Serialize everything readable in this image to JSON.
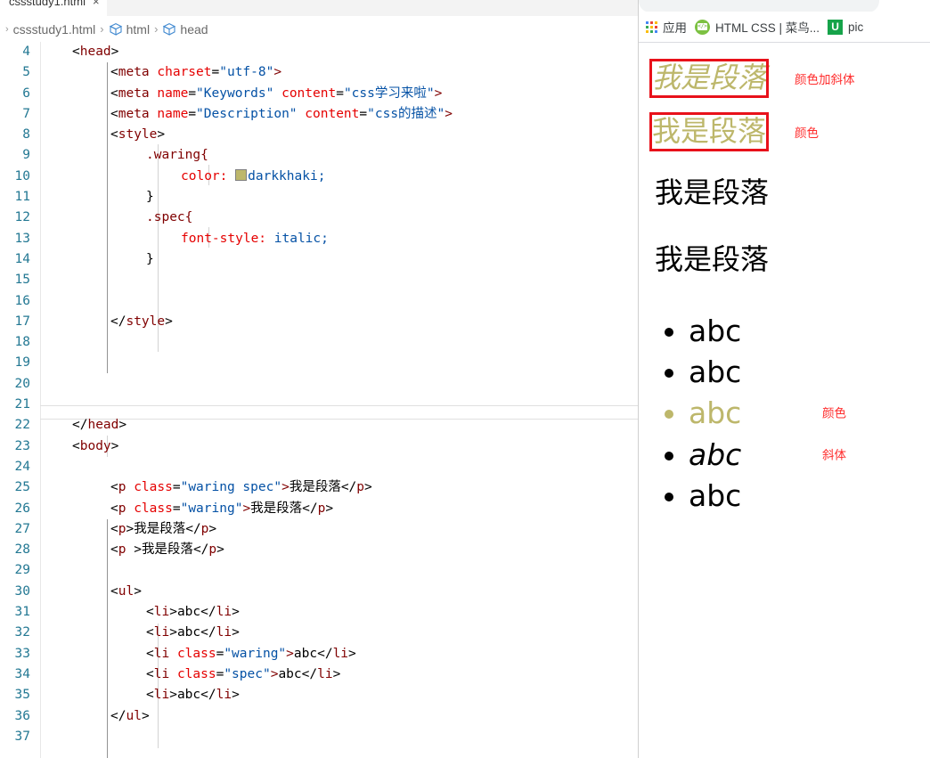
{
  "editor": {
    "tab": {
      "label": "cssstudy1.html",
      "close": "×"
    },
    "breadcrumb": {
      "file": "cssstudy1.html",
      "separator": "›",
      "symbol_icon": "symbol-box-icon",
      "items": [
        "html",
        "head"
      ]
    },
    "code_lines": [
      {
        "n": "4",
        "indent": 0
      },
      {
        "n": "5",
        "indent": 1
      },
      {
        "n": "6",
        "indent": 1
      },
      {
        "n": "7",
        "indent": 1
      },
      {
        "n": "8",
        "indent": 1
      },
      {
        "n": "9",
        "indent": 2
      },
      {
        "n": "10",
        "indent": 3
      },
      {
        "n": "11",
        "indent": 2
      },
      {
        "n": "12",
        "indent": 2
      },
      {
        "n": "13",
        "indent": 3
      },
      {
        "n": "14",
        "indent": 2
      },
      {
        "n": "15",
        "indent": 0
      },
      {
        "n": "16",
        "indent": 0
      },
      {
        "n": "17",
        "indent": 1
      },
      {
        "n": "18",
        "indent": 0
      },
      {
        "n": "19",
        "indent": 0
      },
      {
        "n": "20",
        "indent": 0
      },
      {
        "n": "21",
        "indent": 0
      },
      {
        "n": "22",
        "indent": 0
      },
      {
        "n": "23",
        "indent": 0
      },
      {
        "n": "24",
        "indent": 0
      },
      {
        "n": "25",
        "indent": 1
      },
      {
        "n": "26",
        "indent": 1
      },
      {
        "n": "27",
        "indent": 1
      },
      {
        "n": "28",
        "indent": 1
      },
      {
        "n": "29",
        "indent": 0
      },
      {
        "n": "30",
        "indent": 1
      },
      {
        "n": "31",
        "indent": 2
      },
      {
        "n": "32",
        "indent": 2
      },
      {
        "n": "33",
        "indent": 2
      },
      {
        "n": "34",
        "indent": 2
      },
      {
        "n": "35",
        "indent": 2
      },
      {
        "n": "36",
        "indent": 1
      },
      {
        "n": "37",
        "indent": 0
      }
    ],
    "code_text": {
      "l4": "<head>",
      "l5": "<meta charset=\"utf-8\">",
      "l6": "<meta name=\"Keywords\" content=\"css学习来啦\">",
      "l7": "<meta name=\"Description\" content=\"css的描述\">",
      "l8": "<style>",
      "l9": ".waring{",
      "l10": "color: darkkhaki;",
      "l11": "}",
      "l12": ".spec{",
      "l13": "font-style: italic;",
      "l14": "}",
      "l17": "</style>",
      "l22": "</head>",
      "l23": "<body>",
      "l25": "<p class=\"waring spec\">我是段落</p>",
      "l26": "<p class=\"waring\">我是段落</p>",
      "l27": "<p>我是段落</p>",
      "l28": "<p >我是段落</p>",
      "l30": "<ul>",
      "l31": "<li>abc</li>",
      "l32": "<li>abc</li>",
      "l33": "<li class=\"waring\">abc</li>",
      "l34": "<li class=\"spec\">abc</li>",
      "l35": "<li>abc</li>",
      "l36": "</ul>"
    },
    "tokens": {
      "head_open": "head",
      "meta": "meta",
      "style": "style",
      "body": "body",
      "p": "p",
      "ul": "ul",
      "li": "li",
      "attr_charset": "charset",
      "attr_name": "name",
      "attr_content": "content",
      "attr_class": "class",
      "val_utf8": "\"utf-8\"",
      "val_keywords": "\"Keywords\"",
      "val_keywords_content": "\"css学习来啦\"",
      "val_description": "\"Description\"",
      "val_description_content": "\"css的描述\"",
      "sel_waring": ".waring{",
      "prop_color": "color:",
      "val_darkkhaki": "darkkhaki;",
      "sel_spec": ".spec{",
      "prop_fontstyle": "font-style:",
      "val_italic": "italic;",
      "brace_close": "}",
      "class_waring_spec": "\"waring spec\"",
      "class_waring": "\"waring\"",
      "class_spec": "\"spec\"",
      "text_paragraph": "我是段落",
      "text_abc": "abc",
      "color_swatch": "#bdb76b"
    }
  },
  "browser": {
    "bookmarks": [
      {
        "label": "应用",
        "icon": "apps-grid-icon"
      },
      {
        "label": "HTML CSS | 菜鸟...",
        "icon": "runoob-favicon-icon"
      },
      {
        "label": "pic",
        "icon": "u-favicon-icon"
      }
    ],
    "page": {
      "paragraphs": [
        {
          "text": "我是段落",
          "style": "khaki-italic",
          "boxed": true,
          "note": "颜色加斜体"
        },
        {
          "text": "我是段落",
          "style": "khaki",
          "boxed": true,
          "note": "颜色"
        },
        {
          "text": "我是段落",
          "style": "plain",
          "boxed": false,
          "note": ""
        },
        {
          "text": "我是段落",
          "style": "plain",
          "boxed": false,
          "note": ""
        }
      ],
      "list_items": [
        {
          "text": "abc",
          "style": "plain",
          "note": ""
        },
        {
          "text": "abc",
          "style": "plain",
          "note": ""
        },
        {
          "text": "abc",
          "style": "khaki",
          "note": "颜色"
        },
        {
          "text": "abc",
          "style": "italic",
          "note": "斜体"
        },
        {
          "text": "abc",
          "style": "plain",
          "note": ""
        }
      ]
    }
  },
  "colors": {
    "darkkhaki": "#bdb76b",
    "annotation_red": "#ff2d2d",
    "box_red": "#e8111a",
    "line_number": "#237893"
  }
}
